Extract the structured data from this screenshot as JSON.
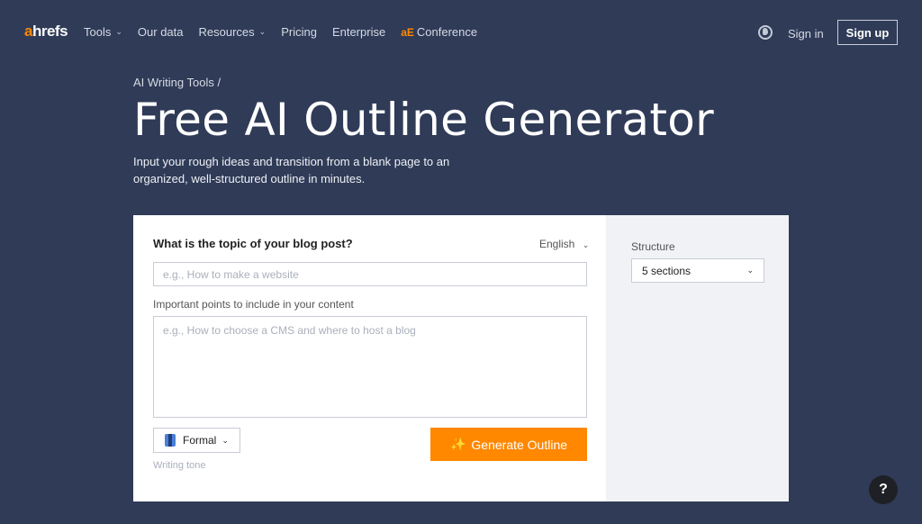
{
  "header": {
    "logo_prefix": "a",
    "logo_rest": "hrefs",
    "nav": [
      {
        "label": "Tools",
        "dropdown": true
      },
      {
        "label": "Our data",
        "dropdown": false
      },
      {
        "label": "Resources",
        "dropdown": true
      },
      {
        "label": "Pricing",
        "dropdown": false
      },
      {
        "label": "Enterprise",
        "dropdown": false
      },
      {
        "label": "Conference",
        "dropdown": false,
        "icon": "aE"
      }
    ],
    "sign_in": "Sign in",
    "sign_up": "Sign up"
  },
  "hero": {
    "breadcrumb": "AI Writing Tools /",
    "title": "Free AI Outline Generator",
    "subtitle": "Input your rough ideas and transition from a blank page to an organized, well-structured outline in minutes."
  },
  "form": {
    "topic_label": "What is the topic of your blog post?",
    "language": "English",
    "topic_placeholder": "e.g., How to make a website",
    "points_label": "Important points to include in your content",
    "points_placeholder": "e.g., How to choose a CMS and where to host a blog",
    "tone_value": "Formal",
    "tone_label": "Writing tone",
    "generate_label": "Generate Outline",
    "structure_label": "Structure",
    "structure_value": "5 sections"
  },
  "help_label": "?",
  "colors": {
    "background": "#2f3b57",
    "accent": "#ff8800",
    "side_panel": "#f1f2f5"
  }
}
